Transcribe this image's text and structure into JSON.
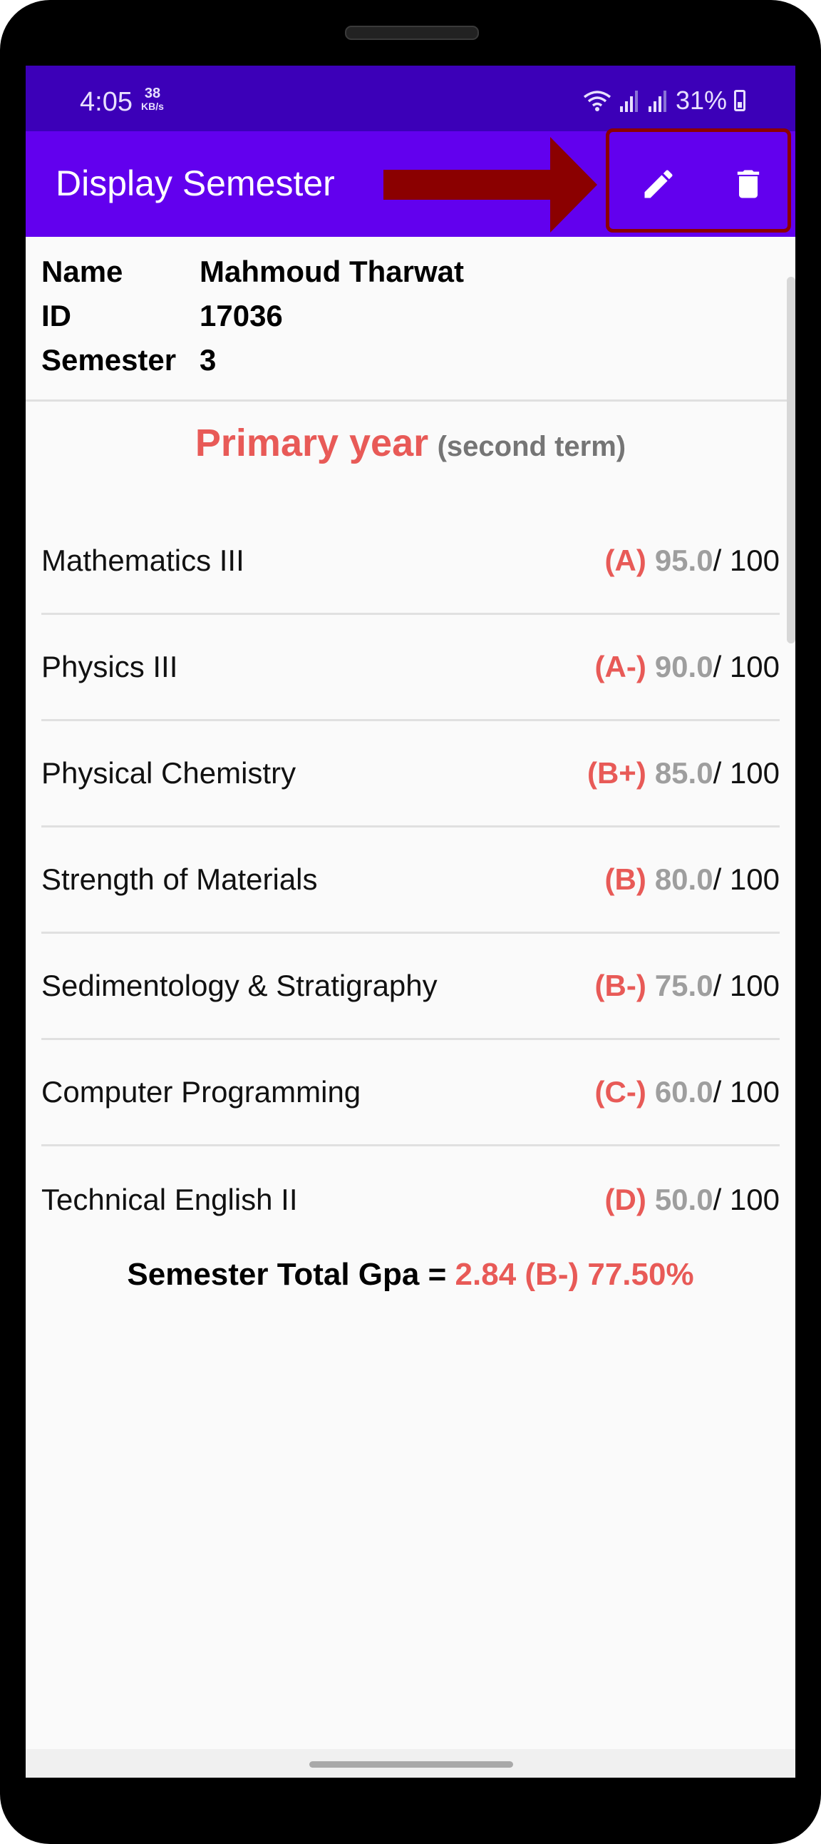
{
  "status_bar": {
    "time": "4:05",
    "speed_value": "38",
    "speed_unit": "KB/s",
    "battery": "31%",
    "icons": [
      "wifi-icon",
      "signal-icon",
      "signal-icon",
      "battery-icon"
    ]
  },
  "app_bar": {
    "title": "Display Semester",
    "actions": [
      {
        "name": "edit",
        "icon": "pencil-icon"
      },
      {
        "name": "delete",
        "icon": "trash-icon"
      }
    ],
    "annotation_color": "#8b0000"
  },
  "student": {
    "name_label": "Name",
    "name": "Mahmoud Tharwat",
    "id_label": "ID",
    "id": "17036",
    "semester_label": "Semester",
    "semester": "3"
  },
  "section": {
    "title": "Primary year",
    "subtitle": "(second term)"
  },
  "courses": [
    {
      "name": "Mathematics III",
      "grade": "(A)",
      "score": "95.0",
      "max": "/ 100"
    },
    {
      "name": "Physics III",
      "grade": "(A-)",
      "score": "90.0",
      "max": "/ 100"
    },
    {
      "name": "Physical Chemistry",
      "grade": "(B+)",
      "score": "85.0",
      "max": "/ 100"
    },
    {
      "name": "Strength of Materials",
      "grade": "(B)",
      "score": "80.0",
      "max": "/ 100"
    },
    {
      "name": "Sedimentology & Stratigraphy",
      "grade": "(B-)",
      "score": "75.0",
      "max": "/ 100"
    },
    {
      "name": "Computer Programming",
      "grade": "(C-)",
      "score": "60.0",
      "max": "/ 100"
    },
    {
      "name": "Technical English II",
      "grade": "(D)",
      "score": "50.0",
      "max": "/ 100"
    }
  ],
  "total": {
    "label": "Semester Total Gpa = ",
    "value": "2.84 (B-) 77.50%"
  },
  "colors": {
    "status_bar": "#3c00b8",
    "app_bar": "#6200ee",
    "accent_red": "#e85a57",
    "muted_gray": "#9e9e9e"
  }
}
